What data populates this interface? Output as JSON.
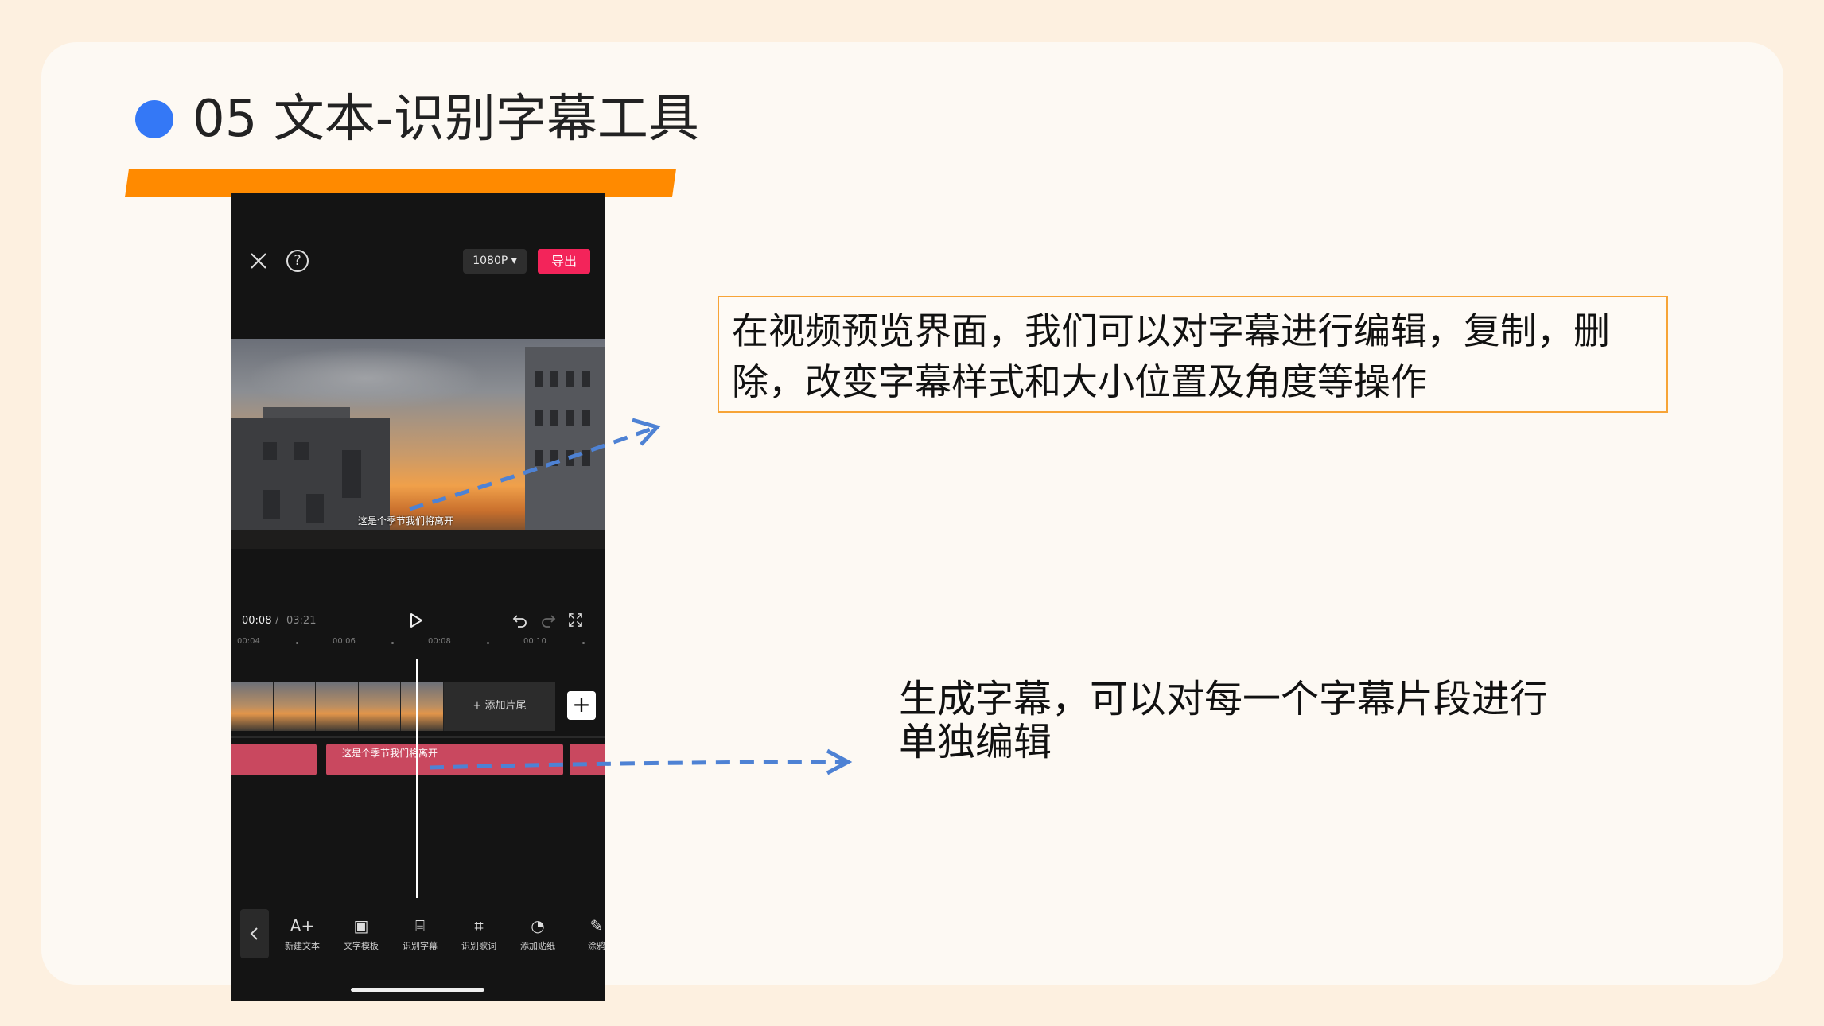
{
  "slide": {
    "title": "05 文本-识别字幕工具",
    "colors": {
      "bullet": "#3478f6",
      "bar": "#ff8a00",
      "callout_border": "#f7a437",
      "arrow": "#4e82d4"
    }
  },
  "app": {
    "top_bar": {
      "close_icon": "close-icon",
      "help_icon": "help-icon",
      "help_glyph": "?",
      "resolution_label": "1080P ▾",
      "export_label": "导出"
    },
    "preview": {
      "subtitle_text": "这是个季节我们将离开"
    },
    "playback": {
      "current_time": "00:08",
      "separator": "/",
      "total_time": "03:21"
    },
    "ruler": [
      "00:04",
      "00:06",
      "00:08",
      "00:10"
    ],
    "timeline": {
      "add_ending_label": "+ 添加片尾",
      "add_clip_glyph": "+",
      "subtitle_clip_label": "这是个季节我们将离开"
    },
    "toolbar": [
      {
        "icon": "A+",
        "label": "新建文本"
      },
      {
        "icon": "▣",
        "label": "文字模板"
      },
      {
        "icon": "⌸",
        "label": "识别字幕"
      },
      {
        "icon": "⌗",
        "label": "识别歌词"
      },
      {
        "icon": "◔",
        "label": "添加贴纸"
      },
      {
        "icon": "✎",
        "label": "涂鸦"
      }
    ]
  },
  "callouts": {
    "preview_note": "在视频预览界面，我们可以对字幕进行编辑，复制，删除，改变字幕样式和大小位置及角度等操作",
    "timeline_note_line1": "生成字幕，可以对每一个字幕片段进行",
    "timeline_note_line2": "单独编辑"
  }
}
